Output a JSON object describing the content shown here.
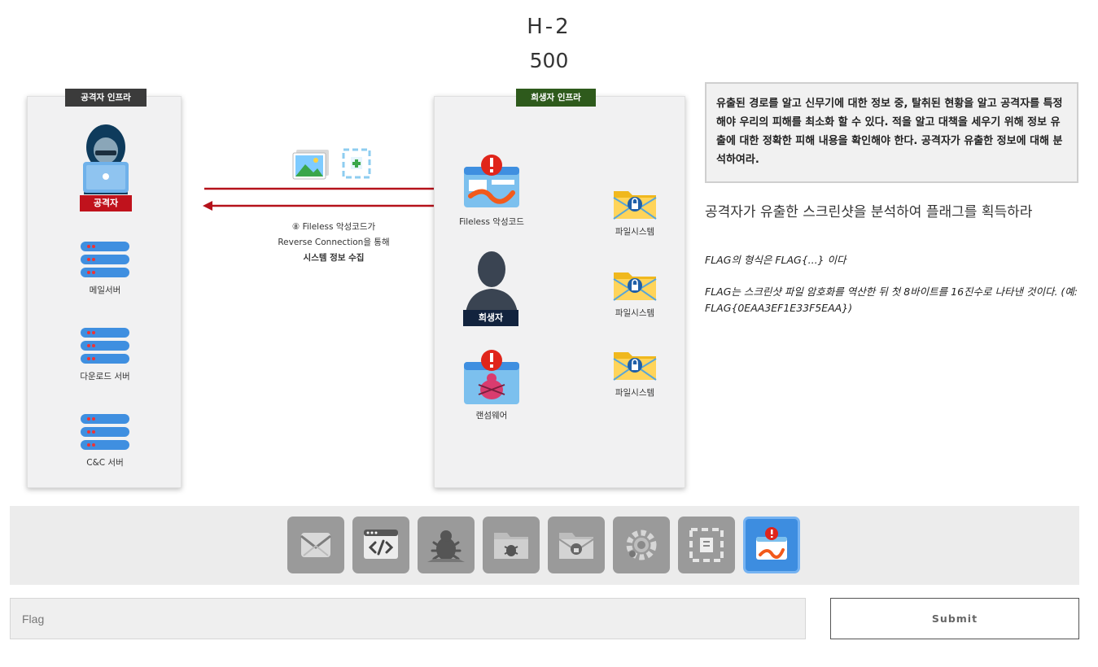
{
  "challenge": {
    "title": "H-2",
    "points": "500"
  },
  "diagram": {
    "attacker_infra_label": "공격자 인프라",
    "victim_infra_label": "희생자 인프라",
    "attacker_label": "공격자",
    "mail_server_label": "메일서버",
    "download_server_label": "다운로드 서버",
    "cc_server_label": "C&C 서버",
    "fileless_label": "Fileless 악성코드",
    "victim_label": "희생자",
    "ransomware_label": "랜섬웨어",
    "filesystem_labels": [
      "파일시스템",
      "파일시스템",
      "파일시스템"
    ],
    "flow_lines": [
      "⑧ Fileless 악성코드가",
      "Reverse Connection을 통해",
      "시스템 정보 수집"
    ],
    "colors": {
      "attacker_tag": "#3b3b3b",
      "victim_tag": "#2e5a1c",
      "arrow": "#b5121b",
      "red_tag": "#c0121c",
      "navy_tag": "#12233e"
    }
  },
  "description": "유출된 경로를 알고 신무기에 대한 정보 중, 탈취된 현황을 알고 공격자를 특정해야 우리의 피해를 최소화 할 수 있다. 적을 알고 대책을 세우기 위해 정보 유출에 대한 정확한 피해 내용을 확인해야 한다. 공격자가 유출한 정보에 대해 분석하여라.",
  "task": "공격자가 유출한 스크린샷을 분석하여 플래그를 획득하라",
  "flag_format": "FLAG의 형식은 FLAG{...} 이다",
  "hint": "FLAG는 스크린샷 파일 암호화를 역산한 뒤 첫 8바이트를 16진수로 나타낸 것이다. (예: FLAG{0EAA3EF1E33F5EAA})",
  "toolbar": {
    "items": [
      {
        "name": "mail-icon"
      },
      {
        "name": "code-icon"
      },
      {
        "name": "bug-icon"
      },
      {
        "name": "bug-folder-icon"
      },
      {
        "name": "locked-folder-icon"
      },
      {
        "name": "gear-icon"
      },
      {
        "name": "screenshot-icon"
      },
      {
        "name": "fileless-malware-icon",
        "active": true
      }
    ]
  },
  "form": {
    "flag_placeholder": "Flag",
    "flag_value": "",
    "submit_label": "Submit"
  }
}
